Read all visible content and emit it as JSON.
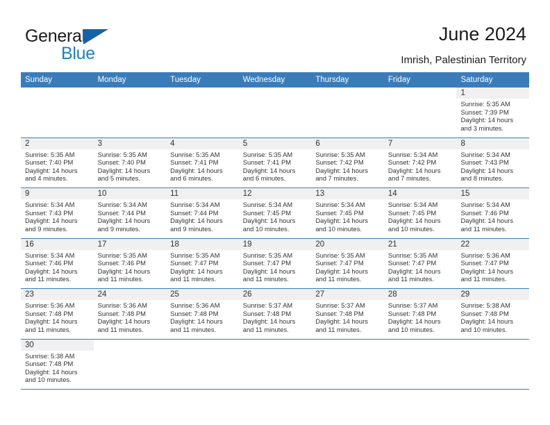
{
  "brand": {
    "name_part1": "General",
    "name_part2": "Blue",
    "flag_icon": "blue-triangle-flag"
  },
  "header": {
    "title": "June 2024",
    "location": "Imrish, Palestinian Territory"
  },
  "colors": {
    "header_blue": "#3a7cb9",
    "brand_blue": "#1f7fc4",
    "cell_band_gray": "#f0f0f0",
    "text_dark": "#1b1b1b"
  },
  "weekdays": [
    "Sunday",
    "Monday",
    "Tuesday",
    "Wednesday",
    "Thursday",
    "Friday",
    "Saturday"
  ],
  "labels": {
    "sunrise_prefix": "Sunrise: ",
    "sunset_prefix": "Sunset: ",
    "daylight_prefix": "Daylight: "
  },
  "weeks": [
    [
      {
        "empty": true
      },
      {
        "empty": true
      },
      {
        "empty": true
      },
      {
        "empty": true
      },
      {
        "empty": true
      },
      {
        "empty": true
      },
      {
        "day": "1",
        "sunrise": "Sunrise: 5:35 AM",
        "sunset": "Sunset: 7:39 PM",
        "daylight": "Daylight: 14 hours and 3 minutes."
      }
    ],
    [
      {
        "day": "2",
        "sunrise": "Sunrise: 5:35 AM",
        "sunset": "Sunset: 7:40 PM",
        "daylight": "Daylight: 14 hours and 4 minutes."
      },
      {
        "day": "3",
        "sunrise": "Sunrise: 5:35 AM",
        "sunset": "Sunset: 7:40 PM",
        "daylight": "Daylight: 14 hours and 5 minutes."
      },
      {
        "day": "4",
        "sunrise": "Sunrise: 5:35 AM",
        "sunset": "Sunset: 7:41 PM",
        "daylight": "Daylight: 14 hours and 6 minutes."
      },
      {
        "day": "5",
        "sunrise": "Sunrise: 5:35 AM",
        "sunset": "Sunset: 7:41 PM",
        "daylight": "Daylight: 14 hours and 6 minutes."
      },
      {
        "day": "6",
        "sunrise": "Sunrise: 5:35 AM",
        "sunset": "Sunset: 7:42 PM",
        "daylight": "Daylight: 14 hours and 7 minutes."
      },
      {
        "day": "7",
        "sunrise": "Sunrise: 5:34 AM",
        "sunset": "Sunset: 7:42 PM",
        "daylight": "Daylight: 14 hours and 7 minutes."
      },
      {
        "day": "8",
        "sunrise": "Sunrise: 5:34 AM",
        "sunset": "Sunset: 7:43 PM",
        "daylight": "Daylight: 14 hours and 8 minutes."
      }
    ],
    [
      {
        "day": "9",
        "sunrise": "Sunrise: 5:34 AM",
        "sunset": "Sunset: 7:43 PM",
        "daylight": "Daylight: 14 hours and 9 minutes."
      },
      {
        "day": "10",
        "sunrise": "Sunrise: 5:34 AM",
        "sunset": "Sunset: 7:44 PM",
        "daylight": "Daylight: 14 hours and 9 minutes."
      },
      {
        "day": "11",
        "sunrise": "Sunrise: 5:34 AM",
        "sunset": "Sunset: 7:44 PM",
        "daylight": "Daylight: 14 hours and 9 minutes."
      },
      {
        "day": "12",
        "sunrise": "Sunrise: 5:34 AM",
        "sunset": "Sunset: 7:45 PM",
        "daylight": "Daylight: 14 hours and 10 minutes."
      },
      {
        "day": "13",
        "sunrise": "Sunrise: 5:34 AM",
        "sunset": "Sunset: 7:45 PM",
        "daylight": "Daylight: 14 hours and 10 minutes."
      },
      {
        "day": "14",
        "sunrise": "Sunrise: 5:34 AM",
        "sunset": "Sunset: 7:45 PM",
        "daylight": "Daylight: 14 hours and 10 minutes."
      },
      {
        "day": "15",
        "sunrise": "Sunrise: 5:34 AM",
        "sunset": "Sunset: 7:46 PM",
        "daylight": "Daylight: 14 hours and 11 minutes."
      }
    ],
    [
      {
        "day": "16",
        "sunrise": "Sunrise: 5:34 AM",
        "sunset": "Sunset: 7:46 PM",
        "daylight": "Daylight: 14 hours and 11 minutes."
      },
      {
        "day": "17",
        "sunrise": "Sunrise: 5:35 AM",
        "sunset": "Sunset: 7:46 PM",
        "daylight": "Daylight: 14 hours and 11 minutes."
      },
      {
        "day": "18",
        "sunrise": "Sunrise: 5:35 AM",
        "sunset": "Sunset: 7:47 PM",
        "daylight": "Daylight: 14 hours and 11 minutes."
      },
      {
        "day": "19",
        "sunrise": "Sunrise: 5:35 AM",
        "sunset": "Sunset: 7:47 PM",
        "daylight": "Daylight: 14 hours and 11 minutes."
      },
      {
        "day": "20",
        "sunrise": "Sunrise: 5:35 AM",
        "sunset": "Sunset: 7:47 PM",
        "daylight": "Daylight: 14 hours and 11 minutes."
      },
      {
        "day": "21",
        "sunrise": "Sunrise: 5:35 AM",
        "sunset": "Sunset: 7:47 PM",
        "daylight": "Daylight: 14 hours and 11 minutes."
      },
      {
        "day": "22",
        "sunrise": "Sunrise: 5:36 AM",
        "sunset": "Sunset: 7:47 PM",
        "daylight": "Daylight: 14 hours and 11 minutes."
      }
    ],
    [
      {
        "day": "23",
        "sunrise": "Sunrise: 5:36 AM",
        "sunset": "Sunset: 7:48 PM",
        "daylight": "Daylight: 14 hours and 11 minutes."
      },
      {
        "day": "24",
        "sunrise": "Sunrise: 5:36 AM",
        "sunset": "Sunset: 7:48 PM",
        "daylight": "Daylight: 14 hours and 11 minutes."
      },
      {
        "day": "25",
        "sunrise": "Sunrise: 5:36 AM",
        "sunset": "Sunset: 7:48 PM",
        "daylight": "Daylight: 14 hours and 11 minutes."
      },
      {
        "day": "26",
        "sunrise": "Sunrise: 5:37 AM",
        "sunset": "Sunset: 7:48 PM",
        "daylight": "Daylight: 14 hours and 11 minutes."
      },
      {
        "day": "27",
        "sunrise": "Sunrise: 5:37 AM",
        "sunset": "Sunset: 7:48 PM",
        "daylight": "Daylight: 14 hours and 11 minutes."
      },
      {
        "day": "28",
        "sunrise": "Sunrise: 5:37 AM",
        "sunset": "Sunset: 7:48 PM",
        "daylight": "Daylight: 14 hours and 10 minutes."
      },
      {
        "day": "29",
        "sunrise": "Sunrise: 5:38 AM",
        "sunset": "Sunset: 7:48 PM",
        "daylight": "Daylight: 14 hours and 10 minutes."
      }
    ],
    [
      {
        "day": "30",
        "sunrise": "Sunrise: 5:38 AM",
        "sunset": "Sunset: 7:48 PM",
        "daylight": "Daylight: 14 hours and 10 minutes."
      },
      {
        "empty": true
      },
      {
        "empty": true
      },
      {
        "empty": true
      },
      {
        "empty": true
      },
      {
        "empty": true
      },
      {
        "empty": true
      }
    ]
  ]
}
